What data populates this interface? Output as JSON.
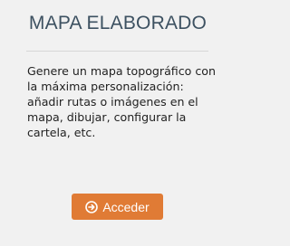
{
  "card": {
    "title": "MAPA ELABORADO",
    "description": "Genere un mapa topográfico con la máxima personalización: añadir rutas o imágenes en el mapa, dibujar, configurar la cartela, etc.",
    "button": {
      "label": "Acceder",
      "icon": "arrow-circle-right-icon"
    }
  },
  "colors": {
    "title": "#3d5161",
    "button_background": "#e07b35",
    "background": "#f1f1f1",
    "divider": "#d6d6d6"
  }
}
